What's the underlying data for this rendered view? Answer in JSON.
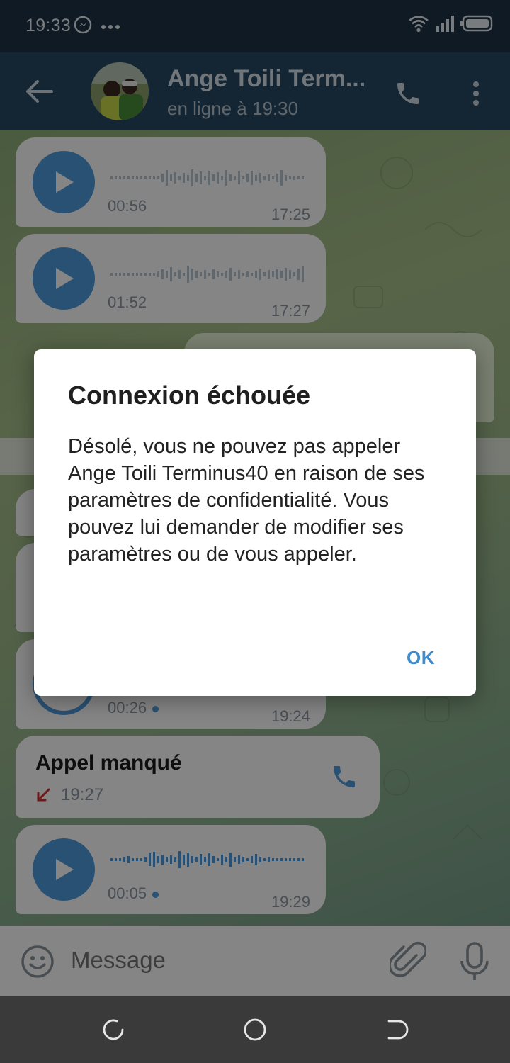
{
  "status_bar": {
    "time": "19:33",
    "left_icons": [
      "messenger-icon",
      "more-dots-icon"
    ],
    "right_icons": [
      "wifi-icon",
      "signal-icon",
      "battery-icon"
    ]
  },
  "header": {
    "contact_name": "Ange Toili Term...",
    "status": "en ligne à 19:30"
  },
  "messages": [
    {
      "type": "voice",
      "duration": "00:56",
      "time": "17:25"
    },
    {
      "type": "voice",
      "duration": "01:52",
      "time": "17:27"
    },
    {
      "type": "voice",
      "duration": "00:26",
      "time": "19:24"
    },
    {
      "type": "missed_call",
      "title": "Appel manqué",
      "time": "19:27"
    },
    {
      "type": "voice",
      "duration": "00:05",
      "time": "19:29"
    }
  ],
  "dialog": {
    "title": "Connexion échouée",
    "body": "Désolé, vous ne pouvez pas appeler Ange Toili Terminus40 en raison de ses paramètres de confidentialité. Vous pouvez lui demander de modifier ses paramètres ou de vous appeler.",
    "ok_label": "OK"
  },
  "input": {
    "placeholder": "Message"
  },
  "colors": {
    "header_bg": "#284a62",
    "accent": "#4f9bdc",
    "dialog_button": "#3f8cd0",
    "missed_red": "#d32f2f"
  }
}
